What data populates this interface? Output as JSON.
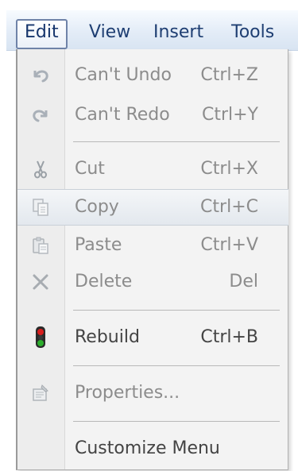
{
  "menubar": {
    "items": [
      {
        "label": "Edit",
        "active": true
      },
      {
        "label": "View",
        "active": false
      },
      {
        "label": "Insert",
        "active": false
      },
      {
        "label": "Tools",
        "active": false
      }
    ]
  },
  "edit_menu": {
    "items": [
      {
        "label": "Can't Undo",
        "shortcut": "Ctrl+Z",
        "icon": "undo-icon",
        "enabled": false
      },
      {
        "label": "Can't Redo",
        "shortcut": "Ctrl+Y",
        "icon": "redo-icon",
        "enabled": false
      },
      {
        "label": "Cut",
        "shortcut": "Ctrl+X",
        "icon": "scissors-icon",
        "enabled": false
      },
      {
        "label": "Copy",
        "shortcut": "Ctrl+C",
        "icon": "copy-icon",
        "enabled": false,
        "highlighted": true
      },
      {
        "label": "Paste",
        "shortcut": "Ctrl+V",
        "icon": "paste-icon",
        "enabled": false
      },
      {
        "label": "Delete",
        "shortcut": "Del",
        "icon": "delete-icon",
        "enabled": false
      },
      {
        "label": "Rebuild",
        "shortcut": "Ctrl+B",
        "icon": "traffic-light-icon",
        "enabled": true
      },
      {
        "label": "Properties...",
        "shortcut": "",
        "icon": "properties-icon",
        "enabled": false
      },
      {
        "label": "Customize Menu",
        "shortcut": "",
        "icon": "",
        "enabled": true
      }
    ]
  },
  "colors": {
    "menubar_text": "#1e3e72",
    "enabled_text": "#444444",
    "disabled_text": "#8c8c8c",
    "menu_background": "#f3f3f3",
    "rebuild_red": "#d81e1e",
    "rebuild_green": "#2cae2c"
  }
}
